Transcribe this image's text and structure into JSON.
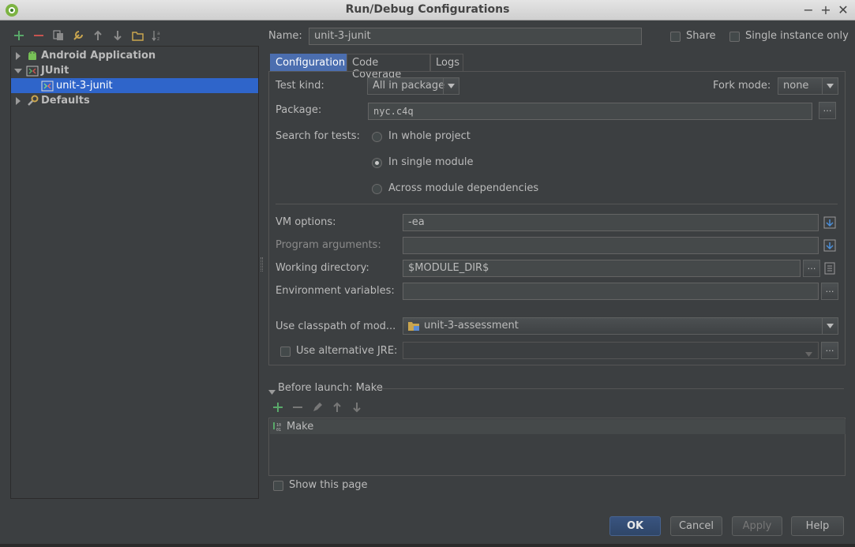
{
  "window": {
    "title": "Run/Debug Configurations"
  },
  "tree": {
    "items": [
      {
        "label": "Android Application",
        "icon": "android-icon"
      },
      {
        "label": "JUnit",
        "icon": "junit-icon"
      },
      {
        "label": "unit-3-junit",
        "icon": "junit-config-icon"
      },
      {
        "label": "Defaults",
        "icon": "wrench-icon"
      }
    ]
  },
  "form": {
    "name_label": "Name:",
    "name_value": "unit-3-junit",
    "share_label": "Share",
    "single_instance_label": "Single instance only"
  },
  "tabs": [
    "Configuration",
    "Code Coverage",
    "Logs"
  ],
  "config": {
    "test_kind_label": "Test kind:",
    "test_kind_value": "All in package",
    "fork_mode_label": "Fork mode:",
    "fork_mode_value": "none",
    "package_label": "Package:",
    "package_value": "nyc.c4q",
    "search_label": "Search for tests:",
    "search_options": [
      "In whole project",
      "In single module",
      "Across module dependencies"
    ],
    "vm_options_label": "VM options:",
    "vm_options_value": "-ea",
    "program_args_label": "Program arguments:",
    "program_args_value": "",
    "working_dir_label": "Working directory:",
    "working_dir_value": "$MODULE_DIR$",
    "env_vars_label": "Environment variables:",
    "env_vars_value": "",
    "classpath_label": "Use classpath of mod...",
    "classpath_value": "unit-3-assessment",
    "alt_jre_label": "Use alternative JRE:",
    "alt_jre_value": ""
  },
  "before_launch": {
    "header": "Before launch: Make",
    "items": [
      "Make"
    ],
    "show_page_label": "Show this page"
  },
  "buttons": {
    "ok": "OK",
    "cancel": "Cancel",
    "apply": "Apply",
    "help": "Help"
  },
  "colors": {
    "accent": "#2f65ca",
    "background": "#3c3f41",
    "add_green": "#59a869",
    "remove_red": "#c75450"
  }
}
